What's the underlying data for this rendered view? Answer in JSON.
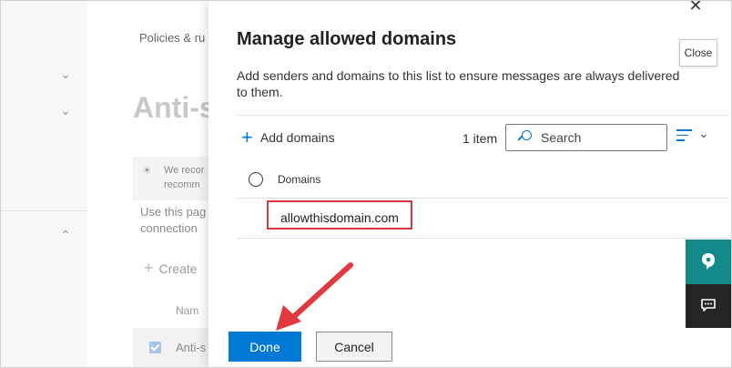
{
  "background": {
    "breadcrumb": "Policies & ru",
    "page_title": "Anti-s",
    "info_line1": "We recor",
    "info_line2": "recomm",
    "body_line1": "Use this pag",
    "body_line2": "connection",
    "create_label": "Create",
    "column_name": "Nam",
    "row_label": "Anti-s"
  },
  "panel": {
    "title": "Manage allowed domains",
    "description": "Add senders and domains to this list to ensure messages are always delivered to them.",
    "close_tooltip": "Close",
    "add_label": "Add domains",
    "item_count": "1 item",
    "search_placeholder": "Search",
    "column_header": "Domains",
    "domains": [
      "allowthisdomain.com"
    ],
    "done_label": "Done",
    "cancel_label": "Cancel"
  },
  "colors": {
    "accent": "#0078d4",
    "highlight": "#d9363e",
    "help_tab": "#138a8a",
    "chat_tab": "#252525"
  },
  "icons": [
    "close-icon",
    "plus-icon",
    "search-icon",
    "filter-icon",
    "chevron-down-icon",
    "radio-icon",
    "help-icon",
    "chat-icon",
    "lightbulb-icon"
  ]
}
